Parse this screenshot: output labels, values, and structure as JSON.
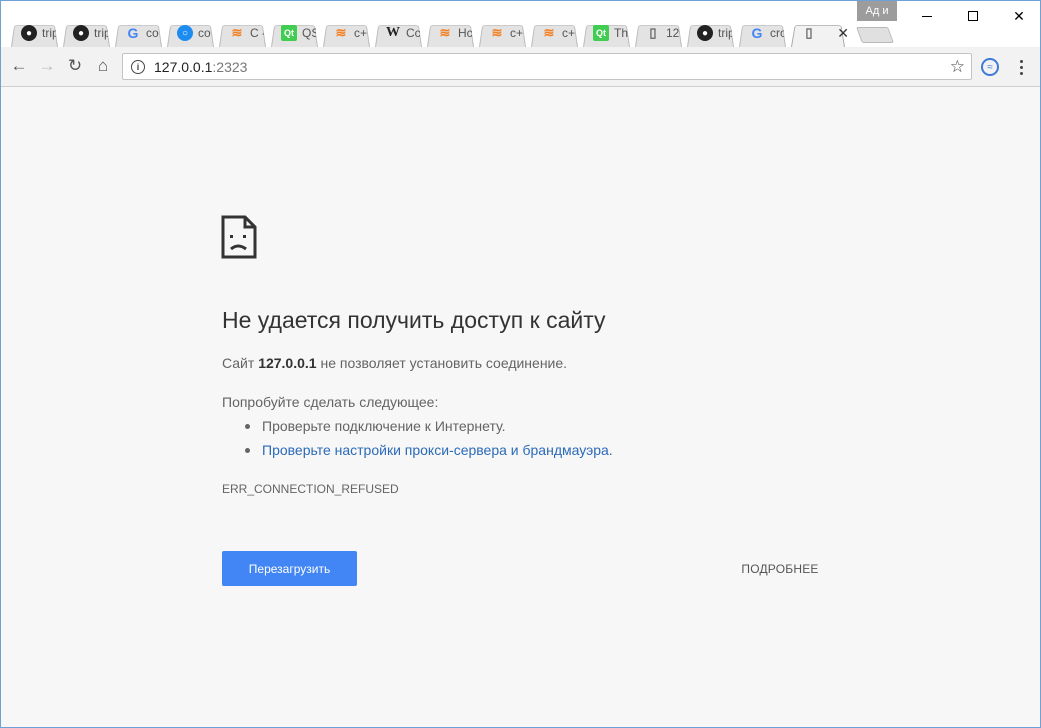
{
  "browser": {
    "user_badge": "Ад и",
    "tabs": [
      {
        "icon": "github-icon",
        "glyph": "●",
        "label": "trip",
        "cls": "fav-github"
      },
      {
        "icon": "github-icon",
        "glyph": "●",
        "label": "trip",
        "cls": "fav-github"
      },
      {
        "icon": "google-icon",
        "glyph": "G",
        "label": "co",
        "cls": "fav-google"
      },
      {
        "icon": "chat-icon",
        "glyph": "○",
        "label": "co",
        "cls": "fav-chat"
      },
      {
        "icon": "stackoverflow-icon",
        "glyph": "≋",
        "label": "C -",
        "cls": "fav-so"
      },
      {
        "icon": "qt-icon",
        "glyph": "Qt",
        "label": "QS",
        "cls": "fav-qt"
      },
      {
        "icon": "stackoverflow-icon",
        "glyph": "≋",
        "label": "c+",
        "cls": "fav-so"
      },
      {
        "icon": "wikipedia-icon",
        "glyph": "W",
        "label": "Cc",
        "cls": "fav-wiki"
      },
      {
        "icon": "stackoverflow-icon",
        "glyph": "≋",
        "label": "Hc",
        "cls": "fav-so"
      },
      {
        "icon": "stackoverflow-icon",
        "glyph": "≋",
        "label": "c+",
        "cls": "fav-so"
      },
      {
        "icon": "stackoverflow-icon",
        "glyph": "≋",
        "label": "c+",
        "cls": "fav-so"
      },
      {
        "icon": "qt-icon",
        "glyph": "Qt",
        "label": "Th",
        "cls": "fav-qt"
      },
      {
        "icon": "document-icon",
        "glyph": "▯",
        "label": "12",
        "cls": "fav-doc"
      },
      {
        "icon": "github-icon",
        "glyph": "●",
        "label": "trip",
        "cls": "fav-github"
      },
      {
        "icon": "google-icon",
        "glyph": "G",
        "label": "cro",
        "cls": "fav-google"
      },
      {
        "icon": "document-icon",
        "glyph": "▯",
        "label": "",
        "cls": "fav-doc",
        "active": true
      }
    ],
    "tab_close_glyph": "✕",
    "window": {
      "minimize": "",
      "maximize": "",
      "close": "✕"
    },
    "toolbar": {
      "back": "←",
      "forward": "→",
      "reload": "↻",
      "home": "⌂",
      "info": "i",
      "url_host": "127.0.0.1",
      "url_port": ":2323",
      "star": "☆",
      "extension": "≈"
    }
  },
  "error_page": {
    "title": "Не удается получить доступ к сайту",
    "desc_prefix": "Сайт ",
    "desc_host": "127.0.0.1",
    "desc_suffix": " не позволяет установить соединение.",
    "suggest_heading": "Попробуйте сделать следующее:",
    "suggestions": [
      {
        "text": "Проверьте подключение к Интернету.",
        "link": false
      },
      {
        "text": "Проверьте настройки прокси-сервера и брандмауэра.",
        "link": true
      }
    ],
    "error_code": "ERR_CONNECTION_REFUSED",
    "reload_button": "Перезагрузить",
    "details_button": "ПОДРОБНЕЕ"
  },
  "colors": {
    "accent": "#4285f4",
    "link": "#2b6ab8",
    "page_bg": "#f7f7f7"
  }
}
